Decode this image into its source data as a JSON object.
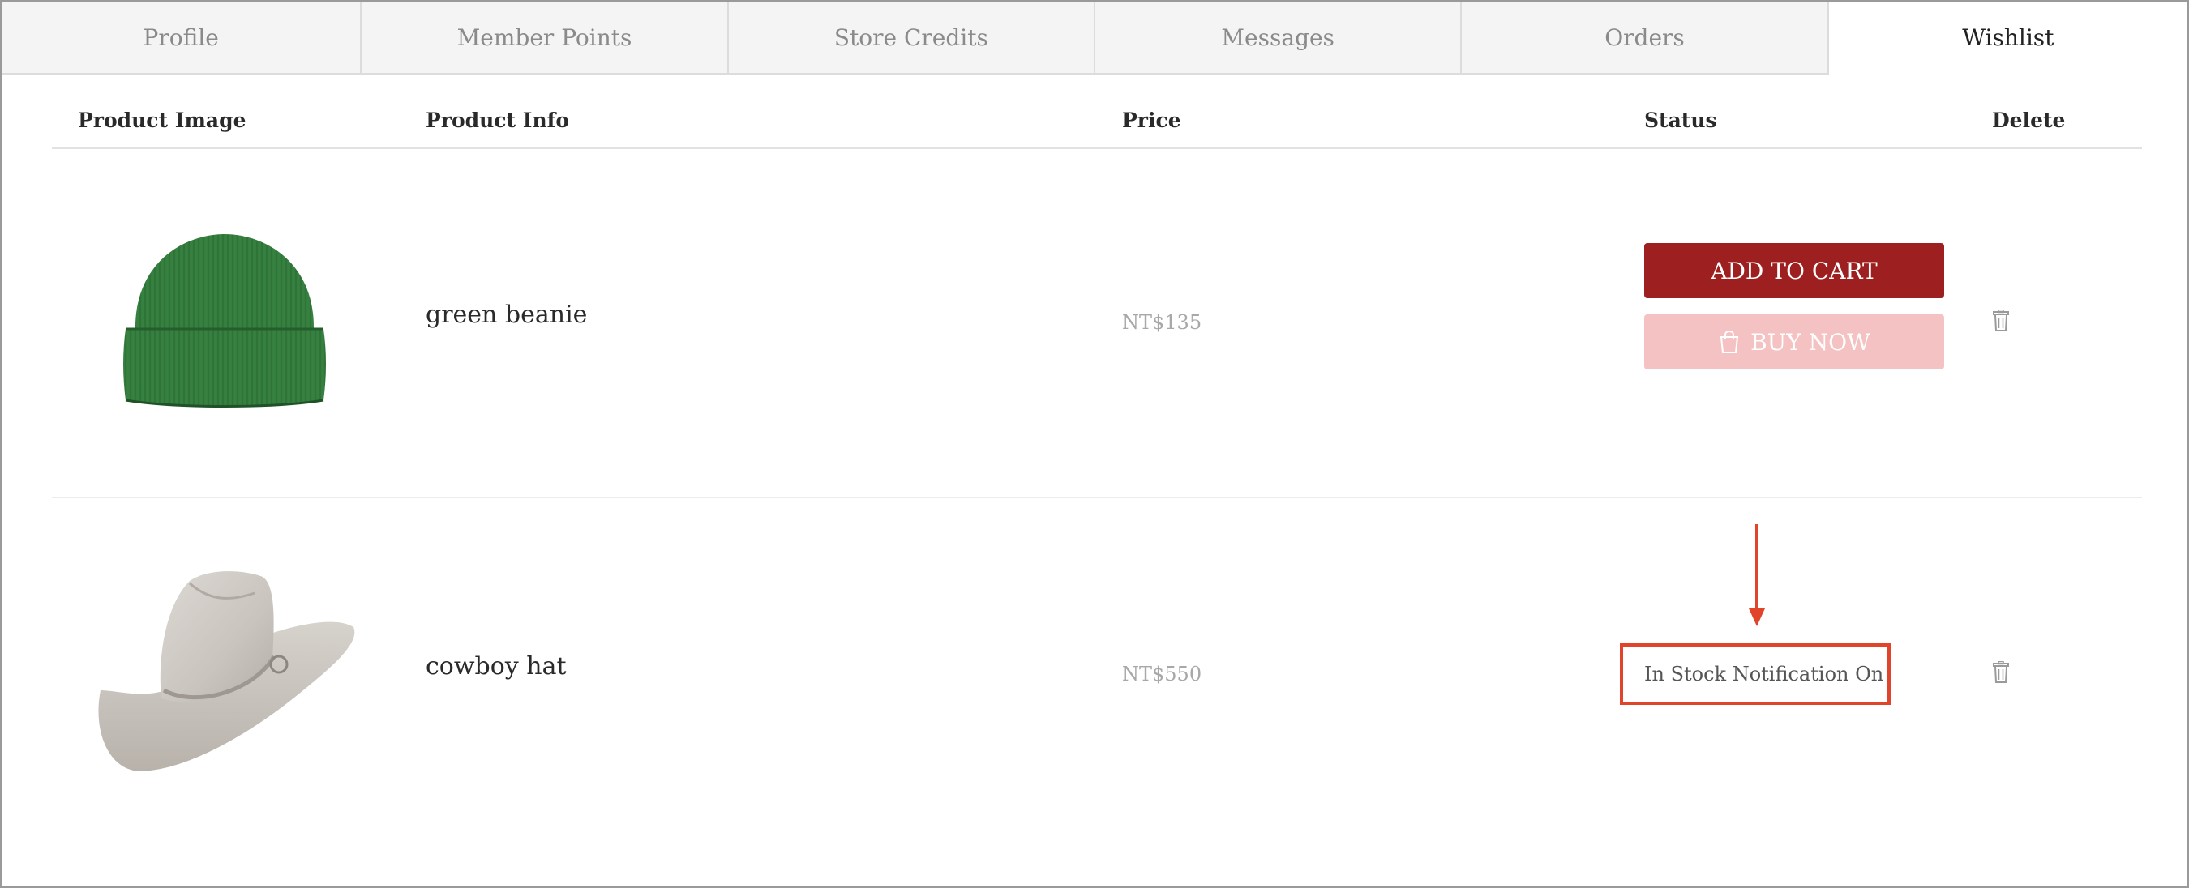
{
  "tabs": [
    {
      "label": "Profile",
      "active": false
    },
    {
      "label": "Member Points",
      "active": false
    },
    {
      "label": "Store Credits",
      "active": false
    },
    {
      "label": "Messages",
      "active": false
    },
    {
      "label": "Orders",
      "active": false
    },
    {
      "label": "Wishlist",
      "active": true
    }
  ],
  "table": {
    "headers": {
      "image": "Product Image",
      "info": "Product Info",
      "price": "Price",
      "status": "Status",
      "delete": "Delete"
    },
    "rows": [
      {
        "name": "green beanie",
        "price": "NT$135",
        "image_icon": "green-beanie-image",
        "actions": {
          "add_to_cart": "ADD TO CART",
          "buy_now": "BUY NOW"
        }
      },
      {
        "name": "cowboy hat",
        "price": "NT$550",
        "image_icon": "cowboy-hat-image",
        "status_text": "In Stock Notification On"
      }
    ]
  },
  "colors": {
    "accent": "#9d1f1f",
    "buy_now_disabled": "#f4c2c2",
    "annotation": "#e0452b"
  }
}
